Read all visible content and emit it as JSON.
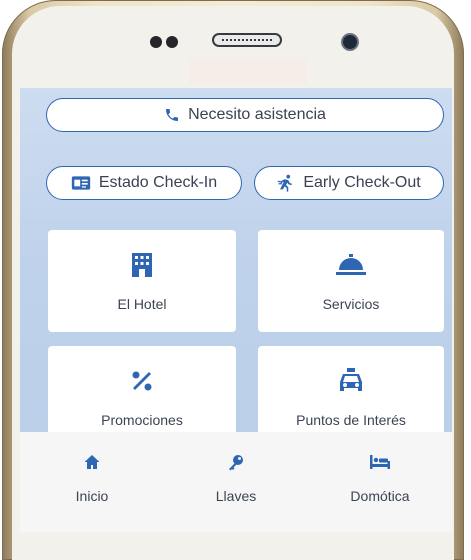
{
  "actions": {
    "assist_label": "Necesito asistencia",
    "checkin_label": "Estado Check-In",
    "checkout_label": "Early Check-Out"
  },
  "tiles": [
    {
      "label": "El Hotel",
      "icon": "hotel-icon"
    },
    {
      "label": "Servicios",
      "icon": "bell-icon"
    },
    {
      "label": "Promociones",
      "icon": "percent-icon"
    },
    {
      "label": "Puntos de Interés",
      "icon": "taxi-icon"
    }
  ],
  "nav": [
    {
      "label": "Inicio",
      "icon": "home-icon"
    },
    {
      "label": "Llaves",
      "icon": "key-icon"
    },
    {
      "label": "Domótica",
      "icon": "bed-icon"
    }
  ],
  "colors": {
    "accent": "#2f66b3",
    "text": "#3b4454",
    "screen_bg": "#c3d5ec"
  }
}
